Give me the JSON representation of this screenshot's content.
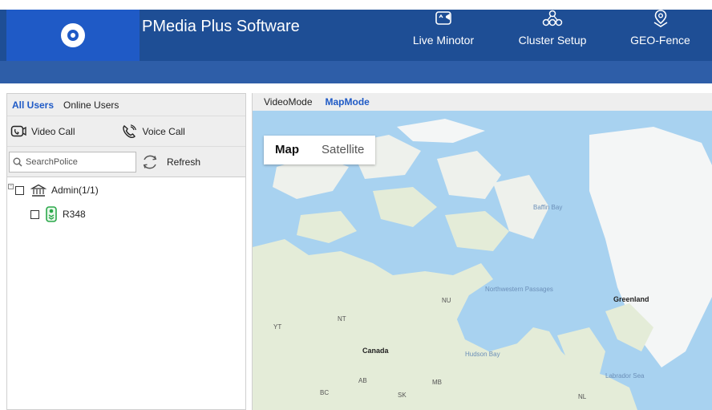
{
  "header": {
    "title": "PMedia Plus Software",
    "nav": [
      {
        "label": "Live Minotor",
        "icon": "camera-icon"
      },
      {
        "label": "Cluster Setup",
        "icon": "cluster-icon"
      },
      {
        "label": "GEO-Fence",
        "icon": "location-pin-icon"
      }
    ]
  },
  "left_panel": {
    "tabs": [
      "All Users",
      "Online Users"
    ],
    "active_tab": "All Users",
    "video_call": "Video Call",
    "voice_call": "Voice Call",
    "search_placeholder": "SearchPolice",
    "refresh": "Refresh",
    "tree": {
      "group": "Admin(1/1)",
      "members": [
        "R348"
      ]
    }
  },
  "map_panel": {
    "tabs": [
      "VideoMode",
      "MapMode"
    ],
    "active_tab": "MapMode",
    "map_types": [
      "Map",
      "Satellite"
    ],
    "active_map_type": "Map",
    "labels": {
      "baffin_bay": "Baffin Bay",
      "greenland": "Greenland",
      "northwestern_passages": "Northwestern Passages",
      "nu": "NU",
      "nt": "NT",
      "yt": "YT",
      "canada": "Canada",
      "hudson_bay": "Hudson Bay",
      "labrador_sea": "Labrador Sea",
      "ab": "AB",
      "mb": "MB",
      "bc": "BC",
      "sk": "SK",
      "nl": "NL"
    }
  },
  "colors": {
    "header_bg": "#1e4e95",
    "logo_bg": "#1f5ac6",
    "accent": "#1f5ac6",
    "water": "#a8d2f0",
    "land": "#e4ecd8",
    "ice": "#f4f6f6"
  }
}
